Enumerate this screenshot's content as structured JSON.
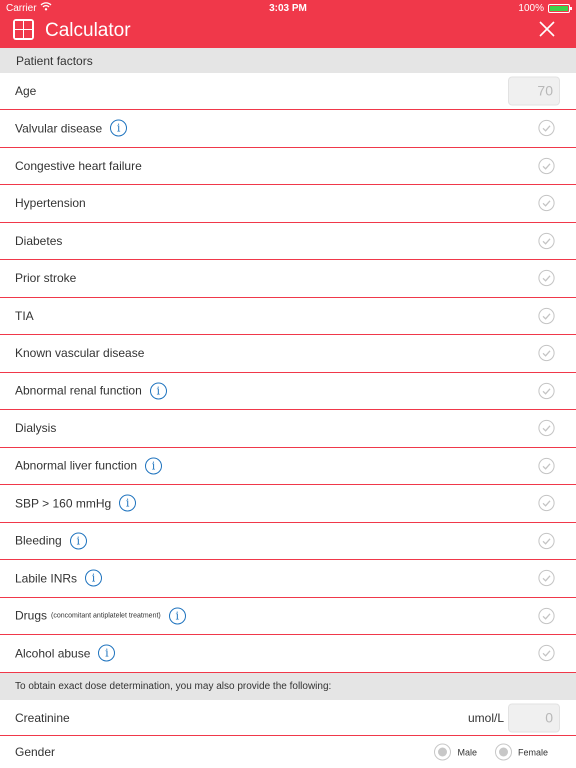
{
  "status_bar": {
    "carrier": "Carrier",
    "time": "3:03 PM",
    "battery": "100%"
  },
  "header": {
    "title": "Calculator",
    "icon": "calculator-icon",
    "close_icon": "close-icon"
  },
  "colors": {
    "accent": "#f0384a",
    "info": "#1e73be",
    "section_bg": "#e5e5e5"
  },
  "patient_factors": {
    "title": "Patient factors",
    "age": {
      "label": "Age",
      "placeholder": "70"
    },
    "items": [
      {
        "label": "Valvular disease",
        "info": true
      },
      {
        "label": "Congestive heart failure",
        "info": false
      },
      {
        "label": "Hypertension",
        "info": false
      },
      {
        "label": "Diabetes",
        "info": false
      },
      {
        "label": "Prior stroke",
        "info": false
      },
      {
        "label": "TIA",
        "info": false
      },
      {
        "label": "Known vascular disease",
        "info": false
      },
      {
        "label": "Abnormal renal function",
        "info": true
      },
      {
        "label": "Dialysis",
        "info": false
      },
      {
        "label": "Abnormal liver function",
        "info": true
      },
      {
        "label": "SBP > 160 mmHg",
        "info": true
      },
      {
        "label": "Bleeding",
        "info": true
      },
      {
        "label": "Labile INRs",
        "info": true
      },
      {
        "label": "Drugs",
        "note": "(concomitant antiplatelet treatment)",
        "info": true
      },
      {
        "label": "Alcohol abuse",
        "info": true
      }
    ]
  },
  "dose": {
    "title": "To obtain exact dose determination, you may also provide the following:",
    "creatinine": {
      "label": "Creatinine",
      "unit": "umol/L",
      "placeholder": "0"
    },
    "gender": {
      "label": "Gender",
      "options": [
        "Male",
        "Female"
      ]
    }
  }
}
